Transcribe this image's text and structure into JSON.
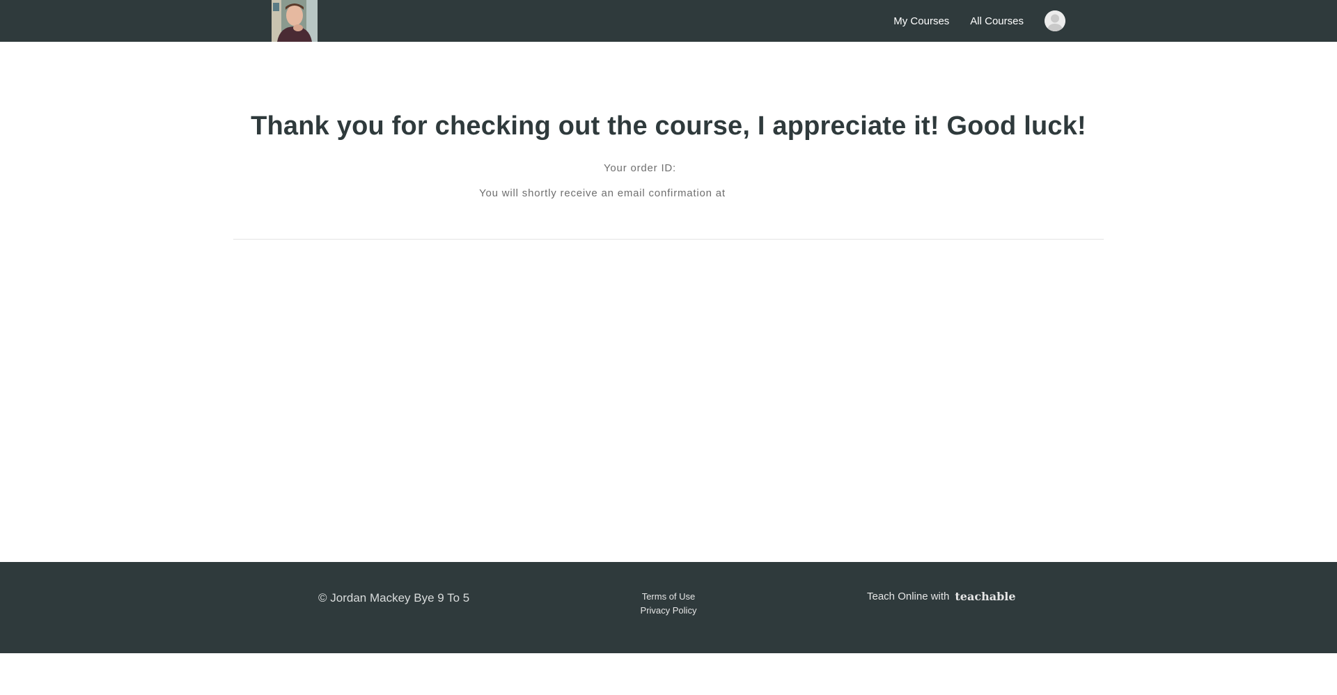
{
  "header": {
    "logo_alt": "instructor-photo-logo",
    "nav": [
      {
        "label": "My Courses"
      },
      {
        "label": "All Courses"
      }
    ],
    "avatar_icon": "user-avatar-icon"
  },
  "main": {
    "headline": "Thank you for checking out the course, I appreciate it! Good luck!",
    "order_id_label": "Your order ID:",
    "email_text": "You will shortly receive an email confirmation at"
  },
  "footer": {
    "copyright": "© Jordan Mackey Bye 9 To 5",
    "links": [
      {
        "label": "Terms of Use"
      },
      {
        "label": "Privacy Policy"
      }
    ],
    "teach_label": "Teach Online with",
    "brand": "teachable"
  },
  "colors": {
    "header_bg": "#2f3a3c",
    "footer_bg": "#2f3a3c",
    "headline": "#2f3a3c",
    "muted_text": "#6e6e6e"
  }
}
